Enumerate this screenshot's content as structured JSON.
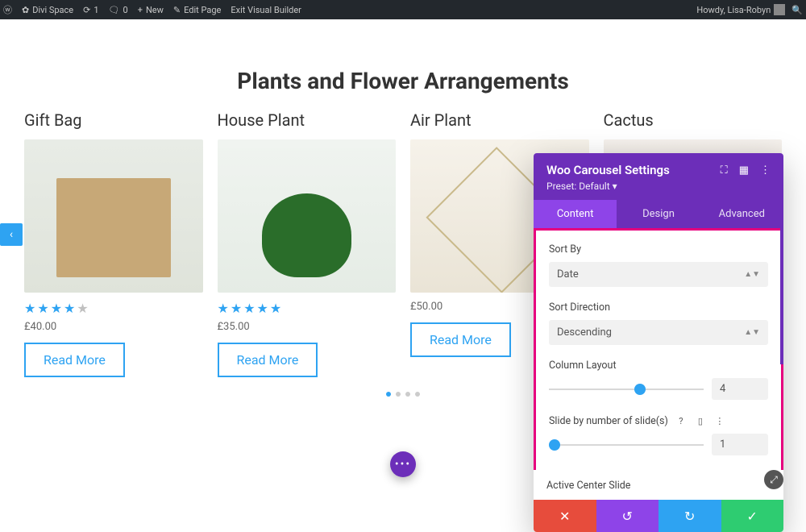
{
  "adminbar": {
    "site": "Divi Space",
    "refresh": "1",
    "comments": "0",
    "newLabel": "New",
    "editPage": "Edit Page",
    "exitBuilder": "Exit Visual Builder",
    "greeting": "Howdy, Lisa-Robyn"
  },
  "page": {
    "title": "Plants and Flower Arrangements"
  },
  "products": [
    {
      "name": "Gift Bag",
      "price": "£40.00",
      "stars": 4,
      "cta": "Read More"
    },
    {
      "name": "House Plant",
      "price": "£35.00",
      "stars": 5,
      "cta": "Read More"
    },
    {
      "name": "Air Plant",
      "price": "£50.00",
      "stars": 0,
      "cta": "Read More"
    },
    {
      "name": "Cactus",
      "price": "",
      "stars": 0,
      "cta": ""
    }
  ],
  "panel": {
    "title": "Woo Carousel Settings",
    "preset": "Preset: Default ▾",
    "tabs": {
      "content": "Content",
      "design": "Design",
      "advanced": "Advanced"
    },
    "sortByLabel": "Sort By",
    "sortByValue": "Date",
    "sortDirLabel": "Sort Direction",
    "sortDirValue": "Descending",
    "columnLabel": "Column Layout",
    "columnValue": "4",
    "slideLabel": "Slide by number of slide(s)",
    "slideValue": "1",
    "activeCenter": "Active Center Slide"
  }
}
